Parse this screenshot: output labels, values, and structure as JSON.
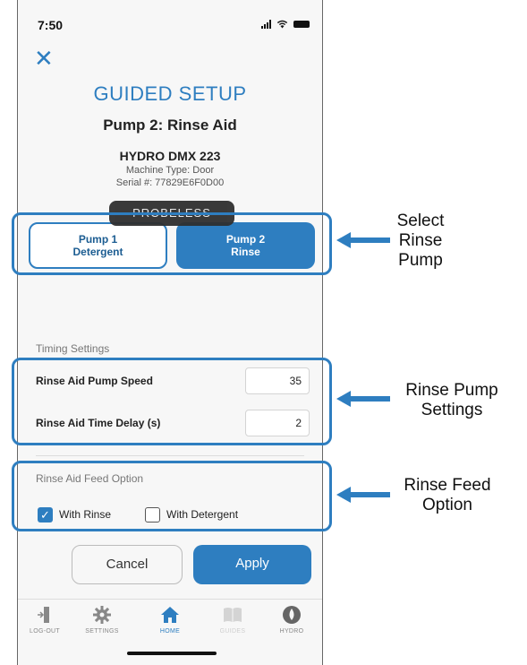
{
  "status_bar": {
    "time": "7:50"
  },
  "header": {
    "title": "GUIDED SETUP",
    "pump_title": "Pump 2: Rinse Aid"
  },
  "machine": {
    "name": "HYDRO DMX 223",
    "type": "Machine Type: Door",
    "serial": "Serial #: 77829E6F0D00"
  },
  "toast": "PROBELESS",
  "pump_selector": {
    "pump1": {
      "line1": "Pump 1",
      "line2": "Detergent",
      "selected": false
    },
    "pump2": {
      "line1": "Pump 2",
      "line2": "Rinse",
      "selected": true
    }
  },
  "timing": {
    "section_label": "Timing Settings",
    "speed_label": "Rinse Aid Pump Speed",
    "speed_value": "35",
    "delay_label": "Rinse Aid Time Delay (s)",
    "delay_value": "2"
  },
  "feed": {
    "section_label": "Rinse Aid Feed Option",
    "with_rinse": {
      "label": "With Rinse",
      "checked": true
    },
    "with_detergent": {
      "label": "With Detergent",
      "checked": false
    }
  },
  "actions": {
    "cancel": "Cancel",
    "apply": "Apply"
  },
  "tabs": [
    {
      "label": "LOG-OUT",
      "icon": "logout-icon"
    },
    {
      "label": "SETTINGS",
      "icon": "gear-icon"
    },
    {
      "label": "HOME",
      "icon": "home-icon",
      "active": true
    },
    {
      "label": "GUIDES",
      "icon": "book-icon",
      "disabled": true
    },
    {
      "label": "HYDRO",
      "icon": "hydro-logo-icon"
    }
  ],
  "callouts": {
    "select_pump": [
      "Select",
      "Rinse",
      "Pump"
    ],
    "pump_settings": [
      "Rinse Pump",
      "Settings"
    ],
    "feed_option": [
      "Rinse Feed",
      "Option"
    ]
  },
  "colors": {
    "accent": "#2e7ec0",
    "background": "#f7f7f7"
  }
}
